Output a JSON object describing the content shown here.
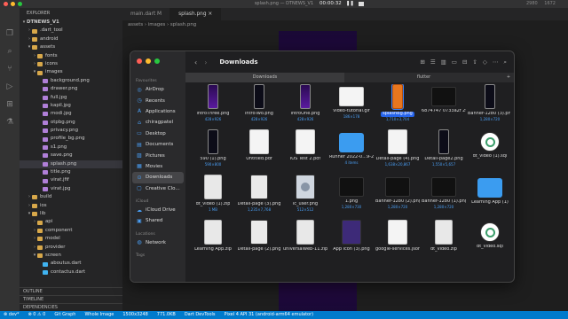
{
  "window_title": "splash.png — DTNEWS_V1",
  "recording": {
    "time": "00:00:32"
  },
  "topright": "2980  1672",
  "explorer": {
    "header": "EXPLORER",
    "project": "DTNEWS_V1",
    "tree": [
      {
        "label": ".dart_tool",
        "depth": 1,
        "type": "folder",
        "open": false
      },
      {
        "label": "android",
        "depth": 1,
        "type": "folder",
        "open": false
      },
      {
        "label": "assets",
        "depth": 1,
        "type": "folder",
        "open": true
      },
      {
        "label": "fonts",
        "depth": 2,
        "type": "folder",
        "open": false
      },
      {
        "label": "icons",
        "depth": 2,
        "type": "folder",
        "open": false
      },
      {
        "label": "images",
        "depth": 2,
        "type": "folder",
        "open": true
      },
      {
        "label": "background.png",
        "depth": 3,
        "type": "image"
      },
      {
        "label": "drawer.png",
        "depth": 3,
        "type": "image"
      },
      {
        "label": "full.jpg",
        "depth": 3,
        "type": "image"
      },
      {
        "label": "kapil.jpg",
        "depth": 3,
        "type": "image"
      },
      {
        "label": "modi.jpg",
        "depth": 3,
        "type": "image"
      },
      {
        "label": "otpbg.png",
        "depth": 3,
        "type": "image"
      },
      {
        "label": "privacy.png",
        "depth": 3,
        "type": "image"
      },
      {
        "label": "profile_bg.png",
        "depth": 3,
        "type": "image"
      },
      {
        "label": "s1.png",
        "depth": 3,
        "type": "image"
      },
      {
        "label": "save.png",
        "depth": 3,
        "type": "image"
      },
      {
        "label": "splash.png",
        "depth": 3,
        "type": "image",
        "selected": true
      },
      {
        "label": "title.png",
        "depth": 3,
        "type": "image"
      },
      {
        "label": "virat.jfif",
        "depth": 3,
        "type": "image"
      },
      {
        "label": "virat.jpg",
        "depth": 3,
        "type": "image"
      },
      {
        "label": "build",
        "depth": 1,
        "type": "folder",
        "open": false
      },
      {
        "label": "ios",
        "depth": 1,
        "type": "folder",
        "open": false
      },
      {
        "label": "lib",
        "depth": 1,
        "type": "folder",
        "open": true
      },
      {
        "label": "api",
        "depth": 2,
        "type": "folder",
        "open": false
      },
      {
        "label": "component",
        "depth": 2,
        "type": "folder",
        "open": false
      },
      {
        "label": "model",
        "depth": 2,
        "type": "folder",
        "open": false
      },
      {
        "label": "provider",
        "depth": 2,
        "type": "folder",
        "open": false
      },
      {
        "label": "screen",
        "depth": 2,
        "type": "folder",
        "open": true
      },
      {
        "label": "aboutus.dart",
        "depth": 3,
        "type": "dart"
      },
      {
        "label": "contactus.dart",
        "depth": 3,
        "type": "dart"
      }
    ],
    "sections": [
      "OUTLINE",
      "TIMELINE",
      "DEPENDENCIES"
    ]
  },
  "editor": {
    "tabs": [
      {
        "label": "main.dart  M",
        "active": false
      },
      {
        "label": "splash.png ×",
        "active": true
      }
    ],
    "breadcrumb": "assets › images › splash.png"
  },
  "status_bar": {
    "items": [
      "⊗ dev*",
      "⊗ 0 ⚠ 0",
      "Git Graph",
      "Whole Image",
      "1500x3248",
      "771.0KB",
      "Dart DevTools",
      "Pixel 4 API 31 (android-arm64 emulator)"
    ]
  },
  "finder": {
    "title": "Downloads",
    "tabs": [
      "Downloads",
      "flutter"
    ],
    "sidebar": {
      "favourites_header": "Favourites",
      "favourites": [
        {
          "label": "AirDrop",
          "icon": "airdrop-icon",
          "glyph": "◎"
        },
        {
          "label": "Recents",
          "icon": "clock-icon",
          "glyph": "◷"
        },
        {
          "label": "Applications",
          "icon": "apps-icon",
          "glyph": "A"
        },
        {
          "label": "chiragpatel",
          "icon": "home-icon",
          "glyph": "⌂"
        },
        {
          "label": "Desktop",
          "icon": "desktop-icon",
          "glyph": "▭"
        },
        {
          "label": "Documents",
          "icon": "document-icon",
          "glyph": "▤"
        },
        {
          "label": "Pictures",
          "icon": "photo-icon",
          "glyph": "▨"
        },
        {
          "label": "Movies",
          "icon": "film-icon",
          "glyph": "▦"
        },
        {
          "label": "Downloads",
          "icon": "download-icon",
          "glyph": "⊙",
          "selected": true
        },
        {
          "label": "Creative Clo...",
          "icon": "file-icon",
          "glyph": "▢"
        }
      ],
      "icloud_header": "iCloud",
      "icloud": [
        {
          "label": "iCloud Drive",
          "icon": "cloud-icon",
          "glyph": "☁"
        },
        {
          "label": "Shared",
          "icon": "shared-folder-icon",
          "glyph": "▣"
        }
      ],
      "locations_header": "Locations",
      "locations": [
        {
          "label": "Network",
          "icon": "globe-icon",
          "glyph": "◍"
        }
      ],
      "tags_header": "Tags"
    },
    "files": [
      {
        "name": "introThree.png",
        "size": "428×926",
        "kind": "phone-purple"
      },
      {
        "name": "introTwo.png",
        "size": "428×926",
        "kind": "phone"
      },
      {
        "name": "introOne.png",
        "size": "428×926",
        "kind": "phone-purple"
      },
      {
        "name": "video-tutorial.gif",
        "size": "186×178",
        "kind": "wide-video"
      },
      {
        "name": "splashBg.png",
        "size": "1,710×3,704",
        "kind": "phone-orange",
        "selected": true
      },
      {
        "name": "6874747 0733a2f 2f692e...6966.gif",
        "size": "",
        "kind": "wide-dark"
      },
      {
        "name": "Banner-1280 (3).png",
        "size": "1,280×720",
        "kind": "phone"
      },
      {
        "name": "590 (1).png",
        "size": "590×800",
        "kind": "phone"
      },
      {
        "name": "Untitled.pdf",
        "size": "",
        "kind": "doc"
      },
      {
        "name": "IOS Test 2.pdf",
        "size": "",
        "kind": "doc"
      },
      {
        "name": "Runner 2022-0...9-29-06",
        "size": "4 items",
        "kind": "folder"
      },
      {
        "name": "Detail-page (4).png",
        "size": "1,638×20,867",
        "kind": "doc"
      },
      {
        "name": "Detail-page2.png",
        "size": "1,550×5,657",
        "kind": "phone"
      },
      {
        "name": "dt_video (1).sql",
        "size": "",
        "kind": "android"
      },
      {
        "name": "dt_video (1).zip",
        "size": "1 MB",
        "kind": "zip"
      },
      {
        "name": "Detail-page (3).png",
        "size": "1,235×7,768",
        "kind": "vid"
      },
      {
        "name": "ic_user.png",
        "size": "512×512",
        "kind": "user"
      },
      {
        "name": "1.png",
        "size": "1,280×730",
        "kind": "wide-dark"
      },
      {
        "name": "Banner-1280 (2).png",
        "size": "1,280×720",
        "kind": "wide-dark"
      },
      {
        "name": "Banner-1280 (1).png",
        "size": "1,280×720",
        "kind": "wide-dark"
      },
      {
        "name": "Learning App (1)",
        "size": "",
        "kind": "folder"
      },
      {
        "name": "Learning App.zip",
        "size": "",
        "kind": "zip"
      },
      {
        "name": "Detail-page (2).png",
        "size": "",
        "kind": "vid"
      },
      {
        "name": "universalweb-11.zip",
        "size": "",
        "kind": "zip"
      },
      {
        "name": "App icon (3).png",
        "size": "",
        "kind": "ppt"
      },
      {
        "name": "google-services.json",
        "size": "",
        "kind": "doc"
      },
      {
        "name": "dt_video.zip",
        "size": "",
        "kind": "zip"
      },
      {
        "name": "dt_video.sql",
        "size": "",
        "kind": "android"
      }
    ]
  },
  "colors": {
    "accent": "#007acc",
    "selection": "#2563eb",
    "folder": "#3b9cf0"
  }
}
